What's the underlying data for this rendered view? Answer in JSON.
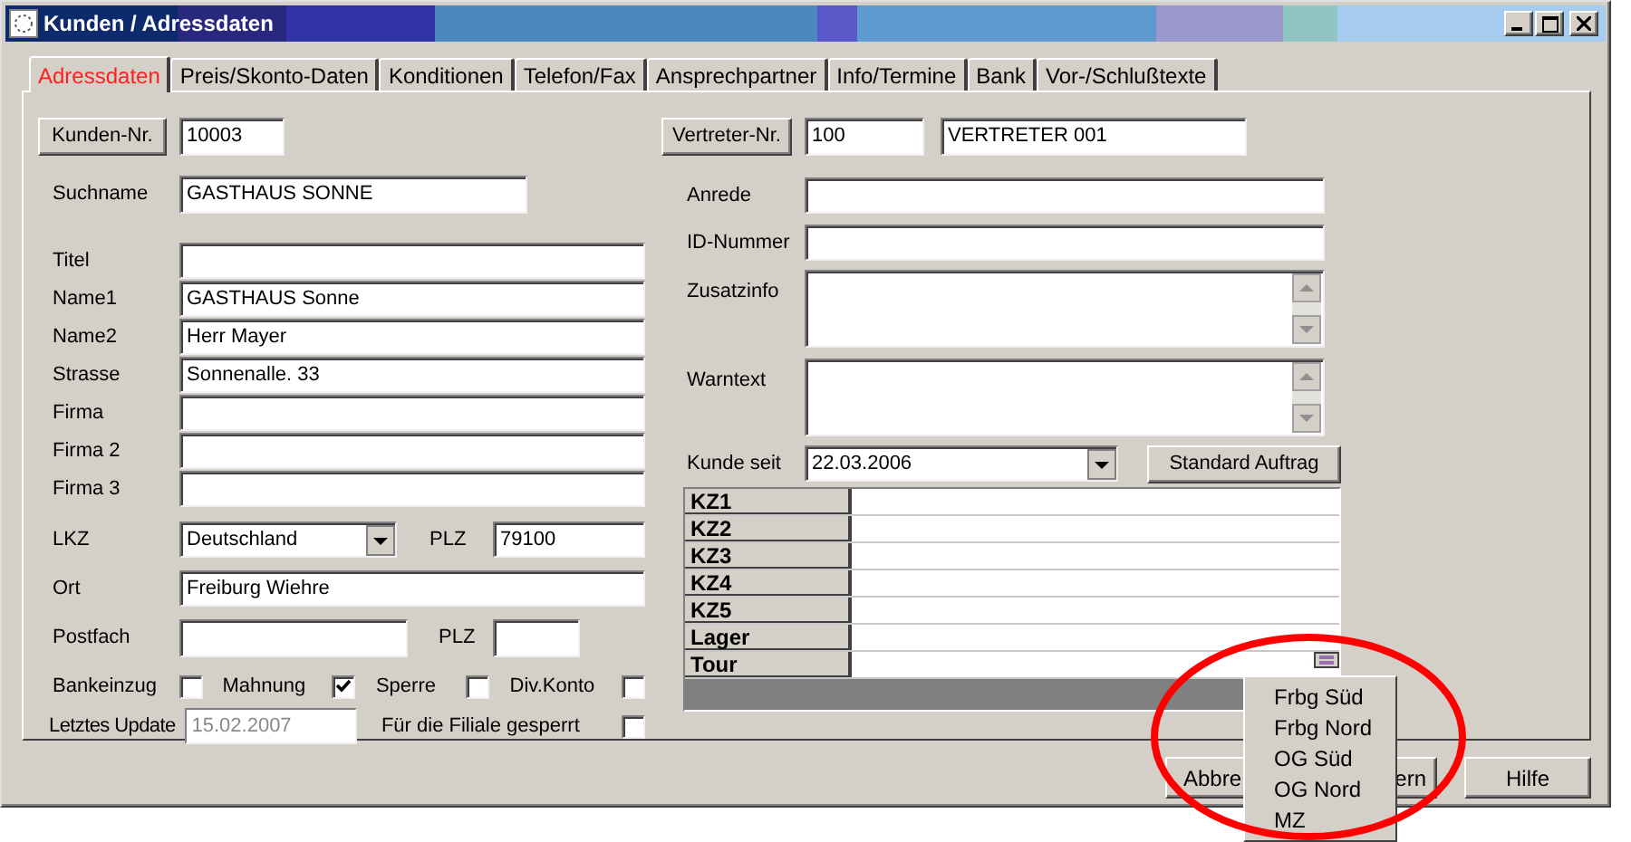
{
  "window": {
    "title": "Kunden / Adressdaten"
  },
  "tabs": [
    {
      "label": "Adressdaten",
      "selected": true
    },
    {
      "label": "Preis/Skonto-Daten",
      "selected": false
    },
    {
      "label": "Konditionen",
      "selected": false
    },
    {
      "label": "Telefon/Fax",
      "selected": false
    },
    {
      "label": "Ansprechpartner",
      "selected": false
    },
    {
      "label": "Info/Termine",
      "selected": false
    },
    {
      "label": "Bank",
      "selected": false
    },
    {
      "label": "Vor-/Schlußtexte",
      "selected": false
    }
  ],
  "left_groups": [
    [
      {
        "kind": "button_field",
        "button": "Kunden-Nr.",
        "value": "10003"
      }
    ],
    [
      {
        "kind": "short_field",
        "label": "Suchname",
        "value": "GASTHAUS SONNE"
      }
    ],
    [
      {
        "kind": "field",
        "label": "Titel"
      },
      {
        "kind": "field",
        "label": "Name1",
        "value": "GASTHAUS Sonne"
      },
      {
        "kind": "field",
        "label": "Name2",
        "value": "Herr Mayer"
      },
      {
        "kind": "field",
        "label": "Strasse",
        "value": "Sonnenalle. 33"
      },
      {
        "kind": "field",
        "label": "Firma"
      },
      {
        "kind": "field",
        "label": "Firma 2"
      },
      {
        "kind": "field",
        "label": "Firma 3"
      }
    ],
    [
      {
        "kind": "select_plz",
        "label": "LKZ",
        "value": "Deutschland",
        "label2": "PLZ",
        "value2": "79100"
      }
    ],
    [
      {
        "kind": "field",
        "label": "Ort",
        "value": "Freiburg Wiehre"
      }
    ],
    [
      {
        "kind": "postfach",
        "label": "Postfach",
        "label2": "PLZ"
      }
    ],
    [
      {
        "kind": "checks",
        "items": [
          {
            "label": "Bankeinzug",
            "checked": false
          },
          {
            "label": "Mahnung",
            "checked": true
          },
          {
            "label": "Sperre",
            "checked": false
          },
          {
            "label": "Div.Konto",
            "checked": false
          }
        ]
      }
    ],
    [
      {
        "kind": "update",
        "label": "Letztes Update",
        "value": "15.02.2007",
        "disabled": true,
        "label2": "Für die Filiale gesperrt",
        "checked": false
      }
    ]
  ],
  "right_groups": [
    [
      {
        "kind": "button_field2",
        "button": "Vertreter-Nr.",
        "value": "100",
        "value2": "VERTRETER 001"
      }
    ],
    [
      {
        "kind": "field",
        "label": "Anrede"
      }
    ],
    [
      {
        "kind": "field",
        "label": "ID-Nummer"
      }
    ],
    [
      {
        "kind": "memo",
        "label": "Zusatzinfo"
      }
    ],
    [
      {
        "kind": "memo",
        "label": "Warntext"
      }
    ],
    [
      {
        "kind": "date_button",
        "label": "Kunde seit",
        "value": "22.03.2006",
        "button": "Standard Auftrag"
      }
    ]
  ],
  "kz_table": {
    "rows": [
      {
        "label": "KZ1",
        "kind": "text"
      },
      {
        "label": "KZ2",
        "kind": "text"
      },
      {
        "label": "KZ3",
        "kind": "text"
      },
      {
        "label": "KZ4",
        "kind": "text"
      },
      {
        "label": "KZ5",
        "kind": "text"
      },
      {
        "label": "Lager",
        "kind": "text"
      },
      {
        "label": "Tour",
        "kind": "picker"
      }
    ]
  },
  "tour_menu": {
    "items": [
      "Frbg Süd",
      "Frbg Nord",
      "OG Süd",
      "OG Nord",
      "MZ"
    ]
  },
  "buttons": [
    {
      "label": "Abbre",
      "kind": "covered_right"
    },
    {
      "label": "ern",
      "kind": "covered_left"
    },
    {
      "label": "Hilfe",
      "kind": "plain"
    }
  ]
}
